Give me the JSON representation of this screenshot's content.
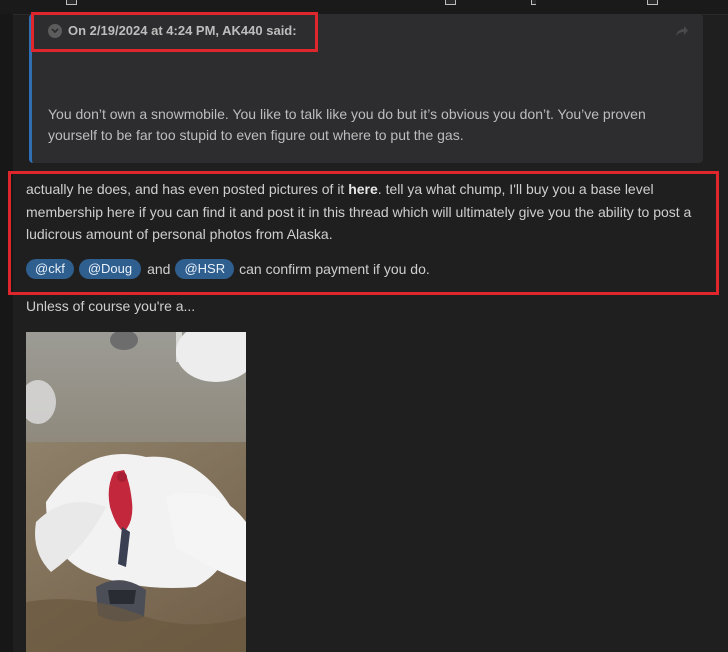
{
  "quote": {
    "header": "On 2/19/2024 at 4:24 PM, AK440 said:",
    "body": "You don’t own a snowmobile. You like to talk like you do but it’s obvious you don’t. You’ve proven yourself to be far too stupid to even figure out where to put the gas."
  },
  "post": {
    "text_before_link": "actually he does, and has even posted pictures of it ",
    "link_text": "here",
    "text_after_link": ".  tell ya what chump, I'll buy you a base level membership here if you can find it and post it in this thread which will ultimately give you the ability to post a ludicrous amount of personal photos from Alaska.",
    "mentions": [
      "@ckf",
      "@Doug",
      "@HSR"
    ],
    "and_word": "and",
    "mentions_tail": "can confirm payment if you do.",
    "closing": "Unless of course you're a..."
  },
  "colors": {
    "highlight": "#e0262d",
    "mention_bg": "#2f5f8f",
    "quote_bar": "#2f6fb3"
  },
  "icons": [
    "expand-icon",
    "share-icon"
  ]
}
